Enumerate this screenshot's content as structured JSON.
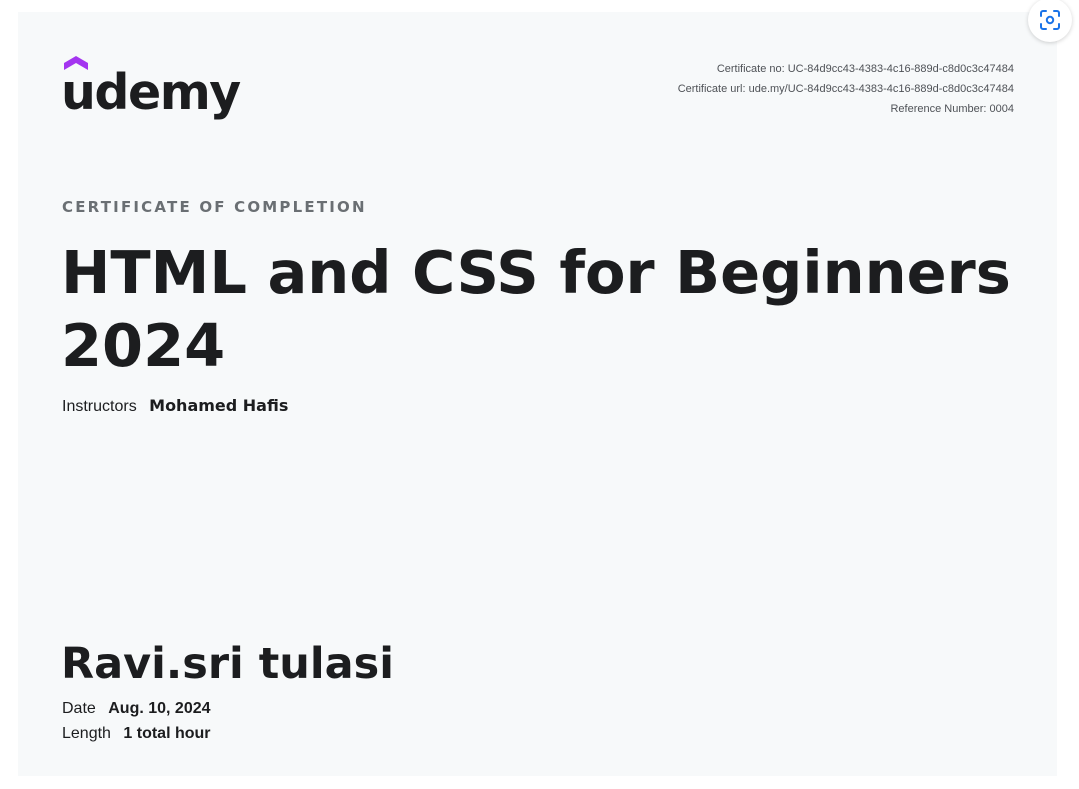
{
  "brand": {
    "name": "udemy",
    "accent_color": "#a435f0"
  },
  "meta": {
    "certificate_no": "Certificate no: UC-84d9cc43-4383-4c16-889d-c8d0c3c47484",
    "certificate_url": "Certificate url: ude.my/UC-84d9cc43-4383-4c16-889d-c8d0c3c47484",
    "reference_number": "Reference Number: 0004"
  },
  "certificate": {
    "heading": "CERTIFICATE OF COMPLETION",
    "course_title": "HTML and CSS for Beginners 2024",
    "instructors_label": "Instructors",
    "instructors_value": "Mohamed Hafis",
    "recipient": "Ravi.sri tulasi",
    "date_label": "Date",
    "date_value": "Aug. 10, 2024",
    "length_label": "Length",
    "length_value": "1 total hour"
  },
  "actions": {
    "lens_icon": "visual-search-icon"
  }
}
